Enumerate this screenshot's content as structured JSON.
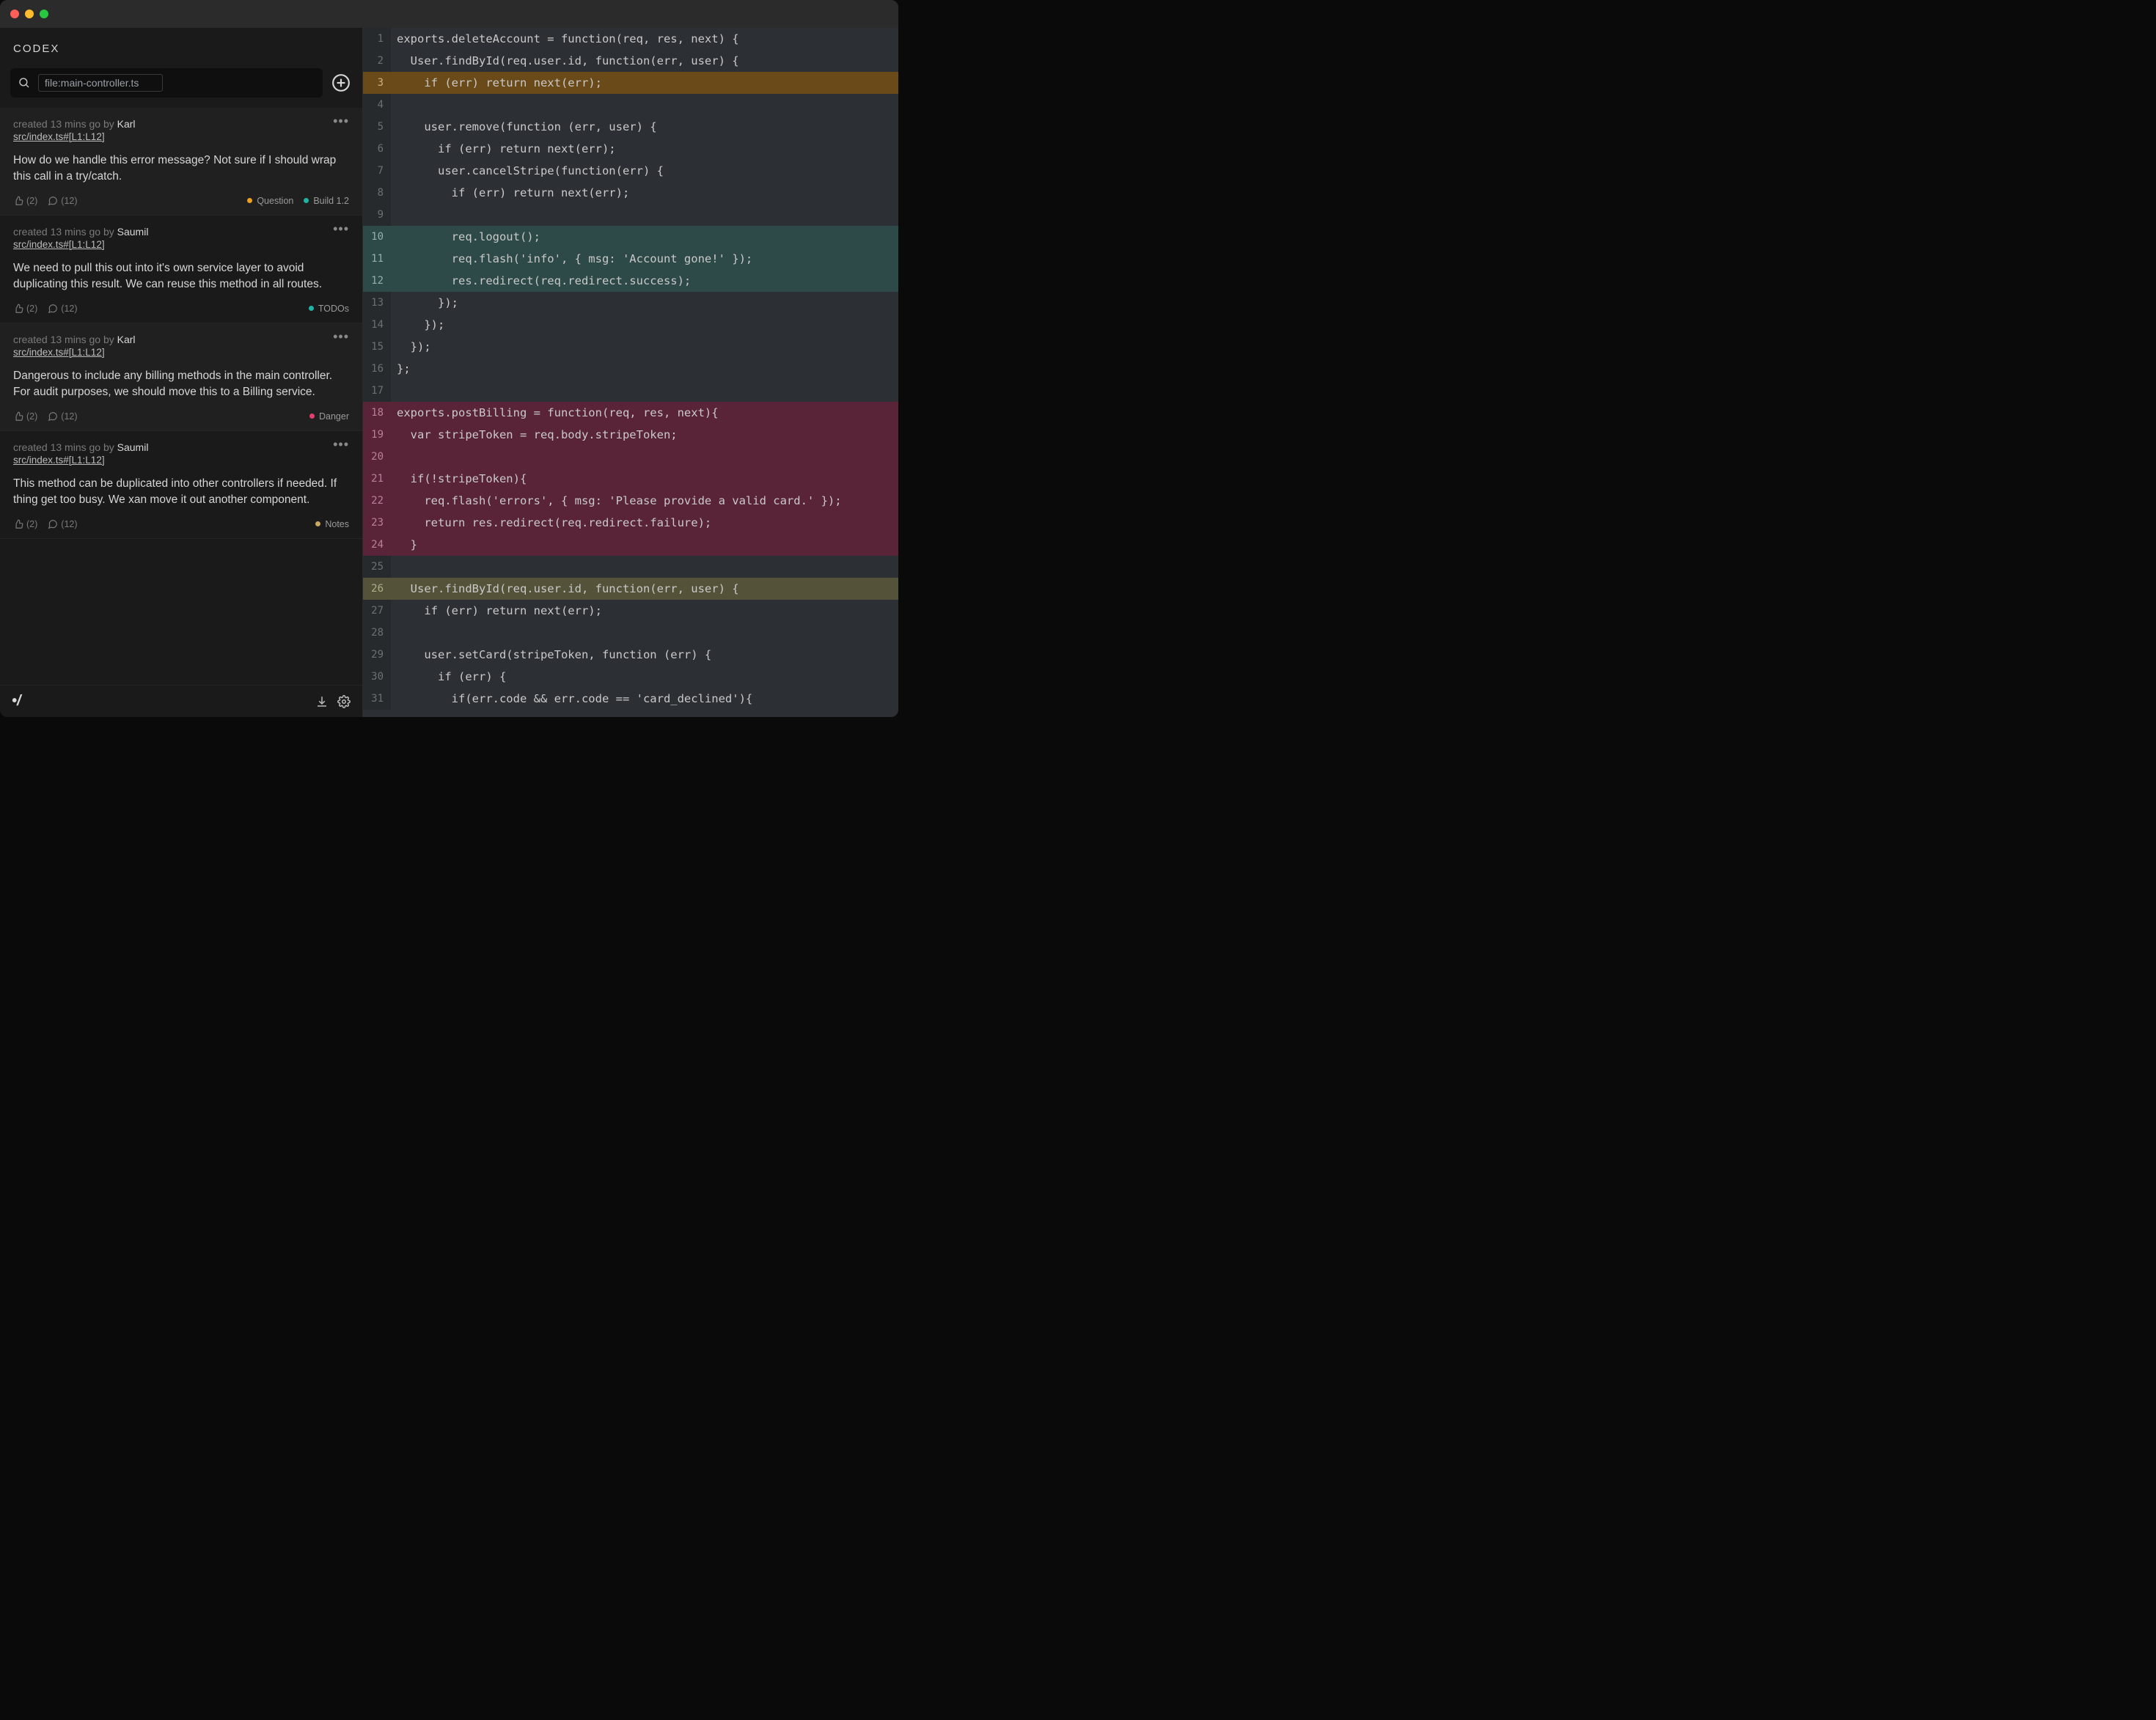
{
  "header": {
    "brand": "CODEX",
    "search_value": "file:main-controller.ts"
  },
  "threads": [
    {
      "meta_prefix": "created 13 mins go by ",
      "author": "Karl",
      "file": "src/index.ts#[L1:L12]",
      "body": "How do we handle this error message? Not sure if I should wrap this call in a try/catch.",
      "likes": "(2)",
      "comments": "(12)",
      "tags": [
        {
          "label": "Question",
          "color": "#f0a020"
        },
        {
          "label": "Build 1.2",
          "color": "#1fb5a5"
        }
      ],
      "alt": true
    },
    {
      "meta_prefix": "created 13 mins go by ",
      "author": "Saumil",
      "file": "src/index.ts#[L1:L12]",
      "body": "We need to pull this out into it's own service layer to avoid duplicating this result. We can reuse this method in all routes.",
      "likes": "(2)",
      "comments": "(12)",
      "tags": [
        {
          "label": "TODOs",
          "color": "#1fb5a5"
        }
      ],
      "alt": false
    },
    {
      "meta_prefix": "created 13 mins go by ",
      "author": "Karl",
      "file": "src/index.ts#[L1:L12]",
      "body": "Dangerous to include any billing methods in the main controller. For audit purposes, we should move this to a Billing service.",
      "likes": "(2)",
      "comments": "(12)",
      "tags": [
        {
          "label": "Danger",
          "color": "#e43f6f"
        }
      ],
      "alt": true
    },
    {
      "meta_prefix": "created 13 mins go by ",
      "author": "Saumil",
      "file": "src/index.ts#[L1:L12]",
      "body": "This method can be duplicated into other controllers if needed. If thing get too busy. We xan move it out another component.",
      "likes": "(2)",
      "comments": "(12)",
      "tags": [
        {
          "label": "Notes",
          "color": "#c9a85f"
        }
      ],
      "alt": false
    }
  ],
  "footer": {
    "brand_mark": "•/"
  },
  "code": {
    "lines": [
      {
        "n": 1,
        "hl": "",
        "text": "exports.deleteAccount = function(req, res, next) {"
      },
      {
        "n": 2,
        "hl": "",
        "text": "  User.findById(req.user.id, function(err, user) {"
      },
      {
        "n": 3,
        "hl": "orange",
        "text": "    if (err) return next(err);"
      },
      {
        "n": 4,
        "hl": "",
        "text": ""
      },
      {
        "n": 5,
        "hl": "",
        "text": "    user.remove(function (err, user) {"
      },
      {
        "n": 6,
        "hl": "",
        "text": "      if (err) return next(err);"
      },
      {
        "n": 7,
        "hl": "",
        "text": "      user.cancelStripe(function(err) {"
      },
      {
        "n": 8,
        "hl": "",
        "text": "        if (err) return next(err);"
      },
      {
        "n": 9,
        "hl": "",
        "text": ""
      },
      {
        "n": 10,
        "hl": "teal",
        "text": "        req.logout();"
      },
      {
        "n": 11,
        "hl": "teal",
        "text": "        req.flash('info', { msg: 'Account gone!' });"
      },
      {
        "n": 12,
        "hl": "teal",
        "text": "        res.redirect(req.redirect.success);"
      },
      {
        "n": 13,
        "hl": "",
        "text": "      });"
      },
      {
        "n": 14,
        "hl": "",
        "text": "    });"
      },
      {
        "n": 15,
        "hl": "",
        "text": "  });"
      },
      {
        "n": 16,
        "hl": "",
        "text": "};"
      },
      {
        "n": 17,
        "hl": "",
        "text": ""
      },
      {
        "n": 18,
        "hl": "maroon",
        "text": "exports.postBilling = function(req, res, next){"
      },
      {
        "n": 19,
        "hl": "maroon",
        "text": "  var stripeToken = req.body.stripeToken;"
      },
      {
        "n": 20,
        "hl": "maroon",
        "text": ""
      },
      {
        "n": 21,
        "hl": "maroon",
        "text": "  if(!stripeToken){"
      },
      {
        "n": 22,
        "hl": "maroon",
        "text": "    req.flash('errors', { msg: 'Please provide a valid card.' });"
      },
      {
        "n": 23,
        "hl": "maroon",
        "text": "    return res.redirect(req.redirect.failure);"
      },
      {
        "n": 24,
        "hl": "maroon",
        "text": "  }"
      },
      {
        "n": 25,
        "hl": "",
        "text": ""
      },
      {
        "n": 26,
        "hl": "olive",
        "text": "  User.findById(req.user.id, function(err, user) {"
      },
      {
        "n": 27,
        "hl": "",
        "text": "    if (err) return next(err);"
      },
      {
        "n": 28,
        "hl": "",
        "text": ""
      },
      {
        "n": 29,
        "hl": "",
        "text": "    user.setCard(stripeToken, function (err) {"
      },
      {
        "n": 30,
        "hl": "",
        "text": "      if (err) {"
      },
      {
        "n": 31,
        "hl": "",
        "text": "        if(err.code && err.code == 'card_declined'){"
      }
    ]
  },
  "colors": {
    "question": "#f0a020",
    "build": "#1fb5a5",
    "todos": "#1fb5a5",
    "danger": "#e43f6f",
    "notes": "#c9a85f"
  }
}
